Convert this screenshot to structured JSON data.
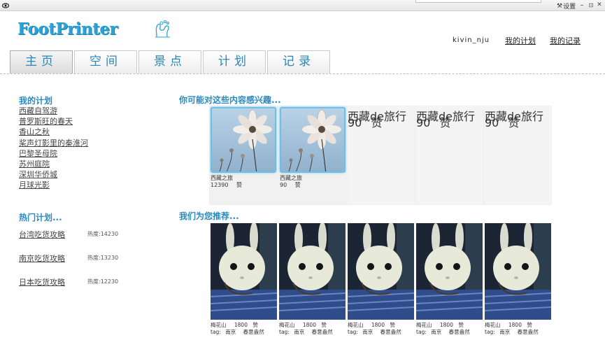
{
  "window": {
    "settings_label": "设置",
    "minimize": "–",
    "restore": "⊡",
    "close": "✕"
  },
  "header": {
    "logo": "FootPrinter",
    "username": "kivin_nju",
    "my_plans_link": "我的计划",
    "my_records_link": "我的记录"
  },
  "nav": {
    "tabs": [
      "主页",
      "空间",
      "景点",
      "计划",
      "记录"
    ],
    "active_index": 0
  },
  "sidebar": {
    "my_plans_title": "我的计划",
    "my_plans": [
      "西藏自驾游",
      "普罗斯旺的春天",
      "香山之秋",
      "桨声灯影里的秦淮河",
      "巴黎圣母院",
      "苏州庭院",
      "深圳华侨城",
      "月球光影"
    ],
    "hot_title": "热门计划...",
    "hot_plans": [
      {
        "name": "台湾吃货攻略",
        "heat": "热度:14230"
      },
      {
        "name": "南京吃货攻略",
        "heat": "热度:13230"
      },
      {
        "name": "日本吃货攻略",
        "heat": "热度:12230"
      }
    ]
  },
  "interest": {
    "title": "你可能对这些内容感兴趣...",
    "cards": [
      {
        "title": "西藏之旅",
        "likes": "12390",
        "like_label": "赞"
      },
      {
        "title": "西藏之旅",
        "likes": "90",
        "like_label": "赞"
      }
    ],
    "text_cells": [
      {
        "title": "西藏de旅行",
        "likes": "90",
        "like_label": "赞"
      },
      {
        "title": "西藏de旅行",
        "likes": "90",
        "like_label": "赞"
      },
      {
        "title": "西藏de旅行",
        "likes": "90",
        "like_label": "赞"
      }
    ]
  },
  "recommend": {
    "title": "我们为您推荐...",
    "items": [
      {
        "place": "梅花山",
        "count": "1800",
        "like_label": "赞",
        "tag_label": "tag:",
        "tags": "南京",
        "mood": "春意盎然"
      },
      {
        "place": "梅花山",
        "count": "1800",
        "like_label": "赞",
        "tag_label": "tag:",
        "tags": "南京",
        "mood": "春意盎然"
      },
      {
        "place": "梅花山",
        "count": "1800",
        "like_label": "赞",
        "tag_label": "tag:",
        "tags": "南京",
        "mood": "春意盎然"
      },
      {
        "place": "梅花山",
        "count": "1800",
        "like_label": "赞",
        "tag_label": "tag:",
        "tags": "南京",
        "mood": "春意盎然"
      },
      {
        "place": "梅花山",
        "count": "1800",
        "like_label": "赞",
        "tag_label": "tag:",
        "tags": "南京",
        "mood": "春意盎然"
      }
    ]
  },
  "colors": {
    "brand": "#2ba3d6",
    "section_title": "#2a8ac0",
    "tab_text": "#2a86b8"
  }
}
